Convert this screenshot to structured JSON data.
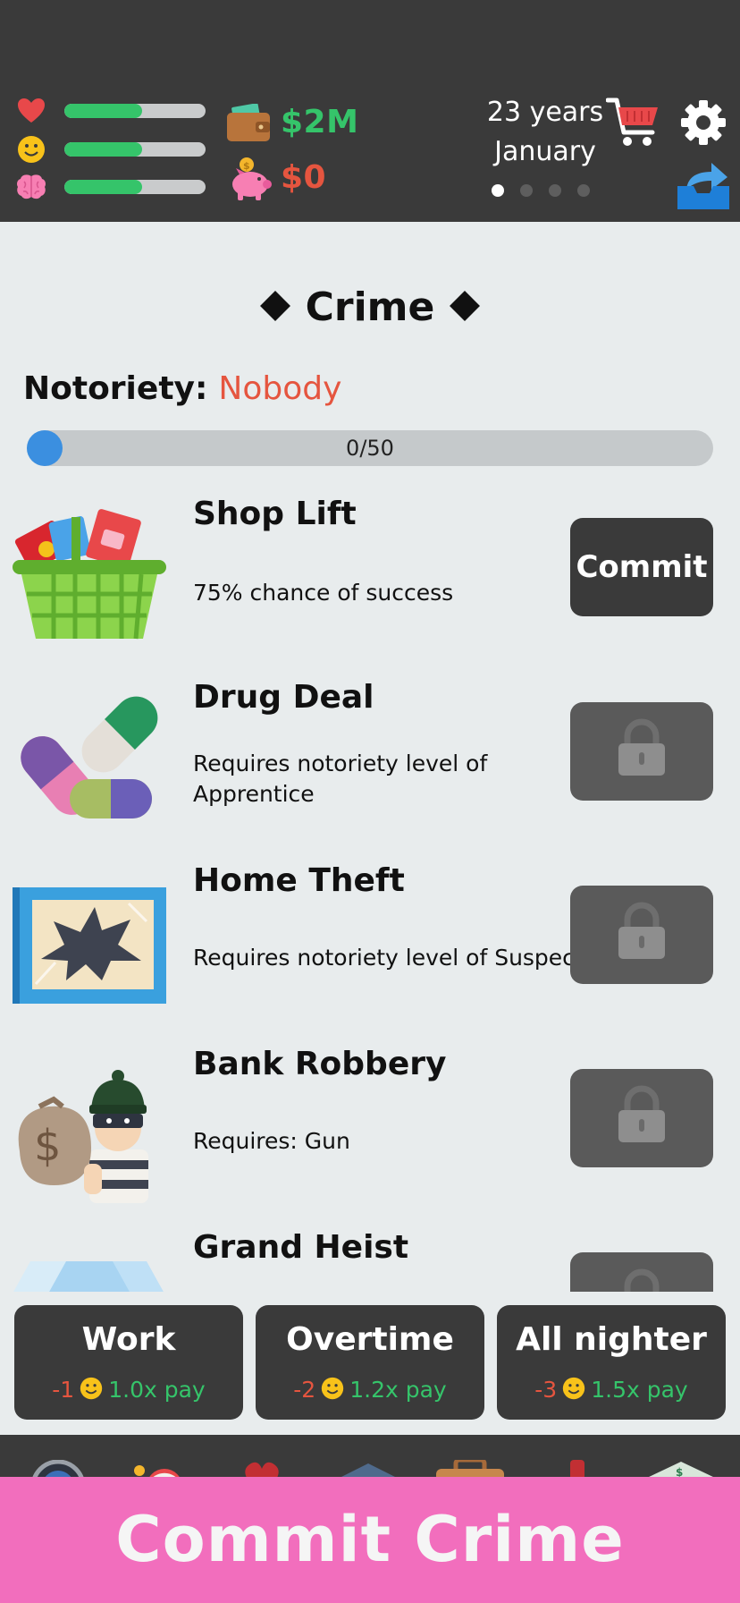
{
  "header": {
    "stats": [
      {
        "name": "health",
        "icon": "heart-icon",
        "level": 0.55
      },
      {
        "name": "happiness",
        "icon": "smiley-icon",
        "level": 0.55
      },
      {
        "name": "smarts",
        "icon": "brain-icon",
        "level": 0.55
      }
    ],
    "cash": "$2M",
    "savings": "$0",
    "age": "23 years",
    "month": "January",
    "page_dots": {
      "total": 4,
      "active": 0
    }
  },
  "crime": {
    "title": "Crime",
    "notoriety_label": "Notoriety:",
    "notoriety_value": "Nobody",
    "progress_text": "0/50",
    "progress": 0,
    "items": [
      {
        "name": "Shop Lift",
        "desc": "75% chance of success",
        "action": "Commit",
        "locked": false,
        "icon": "shopping-basket-icon"
      },
      {
        "name": "Drug Deal",
        "desc": "Requires notoriety level of Apprentice",
        "action": "",
        "locked": true,
        "icon": "pills-icon"
      },
      {
        "name": "Home Theft",
        "desc": "Requires notoriety level of Suspect",
        "action": "",
        "locked": true,
        "icon": "broken-window-icon"
      },
      {
        "name": "Bank Robbery",
        "desc": "Requires: Gun",
        "action": "",
        "locked": true,
        "icon": "robber-icon"
      },
      {
        "name": "Grand Heist",
        "desc": "",
        "action": "",
        "locked": true,
        "icon": "gold-bars-icon"
      }
    ]
  },
  "work": [
    {
      "title": "Work",
      "happiness": "-1",
      "pay": "1.0x pay"
    },
    {
      "title": "Overtime",
      "happiness": "-2",
      "pay": "1.2x pay"
    },
    {
      "title": "All nighter",
      "happiness": "-3",
      "pay": "1.5x pay"
    }
  ],
  "cta": "Commit Crime",
  "colors": {
    "header_bg": "#3A3A3A",
    "accent_green": "#35C46A",
    "accent_red": "#E5553F",
    "cta_pink": "#F26EBD",
    "page_bg": "#E8ECED"
  }
}
